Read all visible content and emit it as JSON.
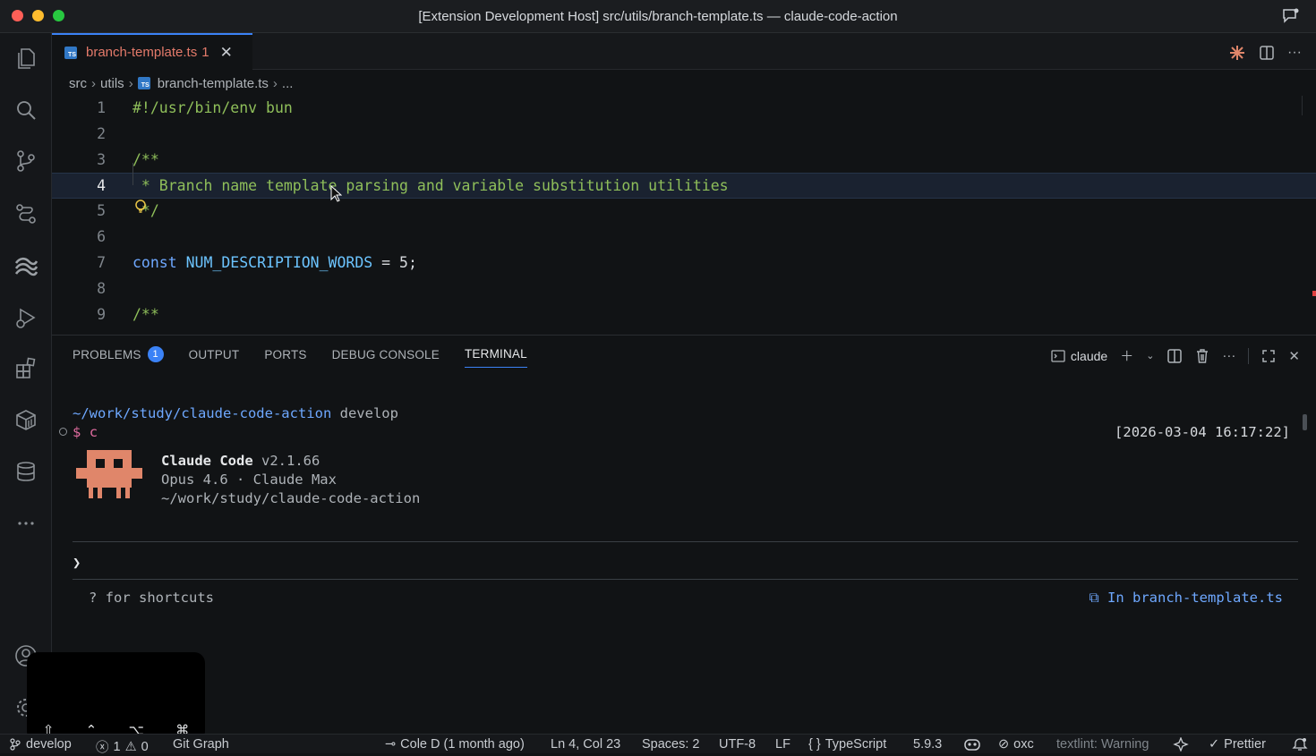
{
  "window": {
    "title": "[Extension Development Host] src/utils/branch-template.ts — claude-code-action"
  },
  "activity_bar": {
    "items": [
      "explorer-icon",
      "search-icon",
      "source-control-icon",
      "git-graph-icon",
      "claude-icon",
      "run-debug-icon",
      "extensions-icon",
      "packages-icon",
      "database-icon",
      "more-icon",
      "accounts-icon",
      "settings-icon"
    ]
  },
  "tab": {
    "label": "branch-template.ts",
    "problems": "1",
    "icon_text": "TS"
  },
  "breadcrumb": {
    "parts": [
      "src",
      "utils",
      "branch-template.ts",
      "..."
    ]
  },
  "code": {
    "lines": [
      {
        "n": "1",
        "text": "#!/usr/bin/env bun"
      },
      {
        "n": "2",
        "text": ""
      },
      {
        "n": "3",
        "text": "/**"
      },
      {
        "n": "4",
        "text": " * Branch name template parsing and variable substitution utilities"
      },
      {
        "n": "5",
        "text": " */"
      },
      {
        "n": "6",
        "text": ""
      },
      {
        "n": "7",
        "kw": "const",
        "name": "NUM_DESCRIPTION_WORDS",
        "rest": " = 5;"
      },
      {
        "n": "8",
        "text": ""
      },
      {
        "n": "9",
        "text": "/**"
      }
    ]
  },
  "panel": {
    "tabs": [
      "PROBLEMS",
      "OUTPUT",
      "PORTS",
      "DEBUG CONSOLE",
      "TERMINAL"
    ],
    "problems_count": "1",
    "terminal_name": "claude"
  },
  "terminal": {
    "path": "~/work/study/claude-code-action",
    "branch": "develop",
    "prompt": "$",
    "command": "c",
    "timestamp": "[2026-03-04 16:17:22]",
    "app_name": "Claude Code",
    "version": "v2.1.66",
    "model": "Opus 4.6 · Claude Max",
    "cwd": "~/work/study/claude-code-action",
    "input_prompt": "❯",
    "hint": "? for shortcuts",
    "context_ref": "⧉ In branch-template.ts"
  },
  "key_overlay": {
    "keys": [
      "⇧",
      "⌃",
      "⌥",
      "⌘"
    ]
  },
  "statusbar": {
    "branch": "develop",
    "errors": "1",
    "warnings": "0",
    "git_graph": "Git Graph",
    "blame": "Cole D (1 month ago)",
    "position": "Ln 4, Col 23",
    "spaces": "Spaces: 2",
    "encoding": "UTF-8",
    "eol": "LF",
    "language": "TypeScript",
    "ts_version": "5.9.3",
    "oxc": "oxc",
    "textlint": "textlint: Warning",
    "prettier": "Prettier"
  },
  "colors": {
    "accent": "#3b82f6",
    "tab_error": "#e37a6a",
    "comment": "#8fbf5a",
    "keyword": "#6ea8ff",
    "mascot": "#e0866a"
  }
}
